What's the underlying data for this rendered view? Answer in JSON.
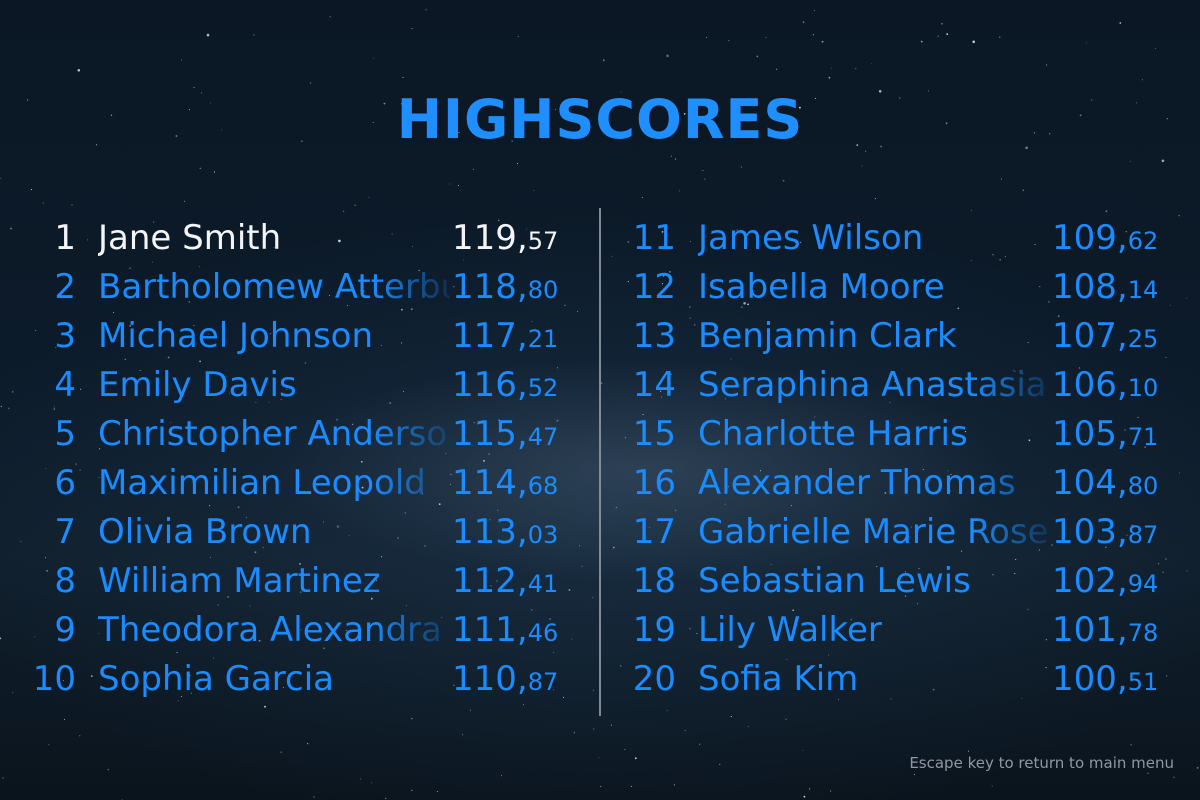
{
  "title": "HIGHSCORES",
  "hint": "Escape key to return to main menu",
  "colors": {
    "accent": "#1f8fff",
    "first_place": "#f2f4f7",
    "divider": "#8d96a0",
    "hint": "#8e98a3"
  },
  "left_column": [
    {
      "rank": "1",
      "name": "Jane Smith",
      "score_int": "119,",
      "score_frac": "57"
    },
    {
      "rank": "2",
      "name": "Bartholomew Atterbury",
      "score_int": "118,",
      "score_frac": "80"
    },
    {
      "rank": "3",
      "name": "Michael Johnson",
      "score_int": "117,",
      "score_frac": "21"
    },
    {
      "rank": "4",
      "name": "Emily Davis",
      "score_int": "116,",
      "score_frac": "52"
    },
    {
      "rank": "5",
      "name": "Christopher Anderson",
      "score_int": "115,",
      "score_frac": "47"
    },
    {
      "rank": "6",
      "name": "Maximilian Leopold",
      "score_int": "114,",
      "score_frac": "68"
    },
    {
      "rank": "7",
      "name": "Olivia Brown",
      "score_int": "113,",
      "score_frac": "03"
    },
    {
      "rank": "8",
      "name": "William Martinez",
      "score_int": "112,",
      "score_frac": "41"
    },
    {
      "rank": "9",
      "name": "Theodora Alexandra",
      "score_int": "111,",
      "score_frac": "46"
    },
    {
      "rank": "10",
      "name": "Sophia Garcia",
      "score_int": "110,",
      "score_frac": "87"
    }
  ],
  "right_column": [
    {
      "rank": "11",
      "name": "James Wilson",
      "score_int": "109,",
      "score_frac": "62"
    },
    {
      "rank": "12",
      "name": "Isabella Moore",
      "score_int": "108,",
      "score_frac": "14"
    },
    {
      "rank": "13",
      "name": "Benjamin Clark",
      "score_int": "107,",
      "score_frac": "25"
    },
    {
      "rank": "14",
      "name": "Seraphina Anastasia",
      "score_int": "106,",
      "score_frac": "10"
    },
    {
      "rank": "15",
      "name": "Charlotte Harris",
      "score_int": "105,",
      "score_frac": "71"
    },
    {
      "rank": "16",
      "name": "Alexander Thomas",
      "score_int": "104,",
      "score_frac": "80"
    },
    {
      "rank": "17",
      "name": "Gabrielle Marie Rose",
      "score_int": "103,",
      "score_frac": "87"
    },
    {
      "rank": "18",
      "name": "Sebastian Lewis",
      "score_int": "102,",
      "score_frac": "94"
    },
    {
      "rank": "19",
      "name": "Lily Walker",
      "score_int": "101,",
      "score_frac": "78"
    },
    {
      "rank": "20",
      "name": "Sofia Kim",
      "score_int": "100,",
      "score_frac": "51"
    }
  ]
}
